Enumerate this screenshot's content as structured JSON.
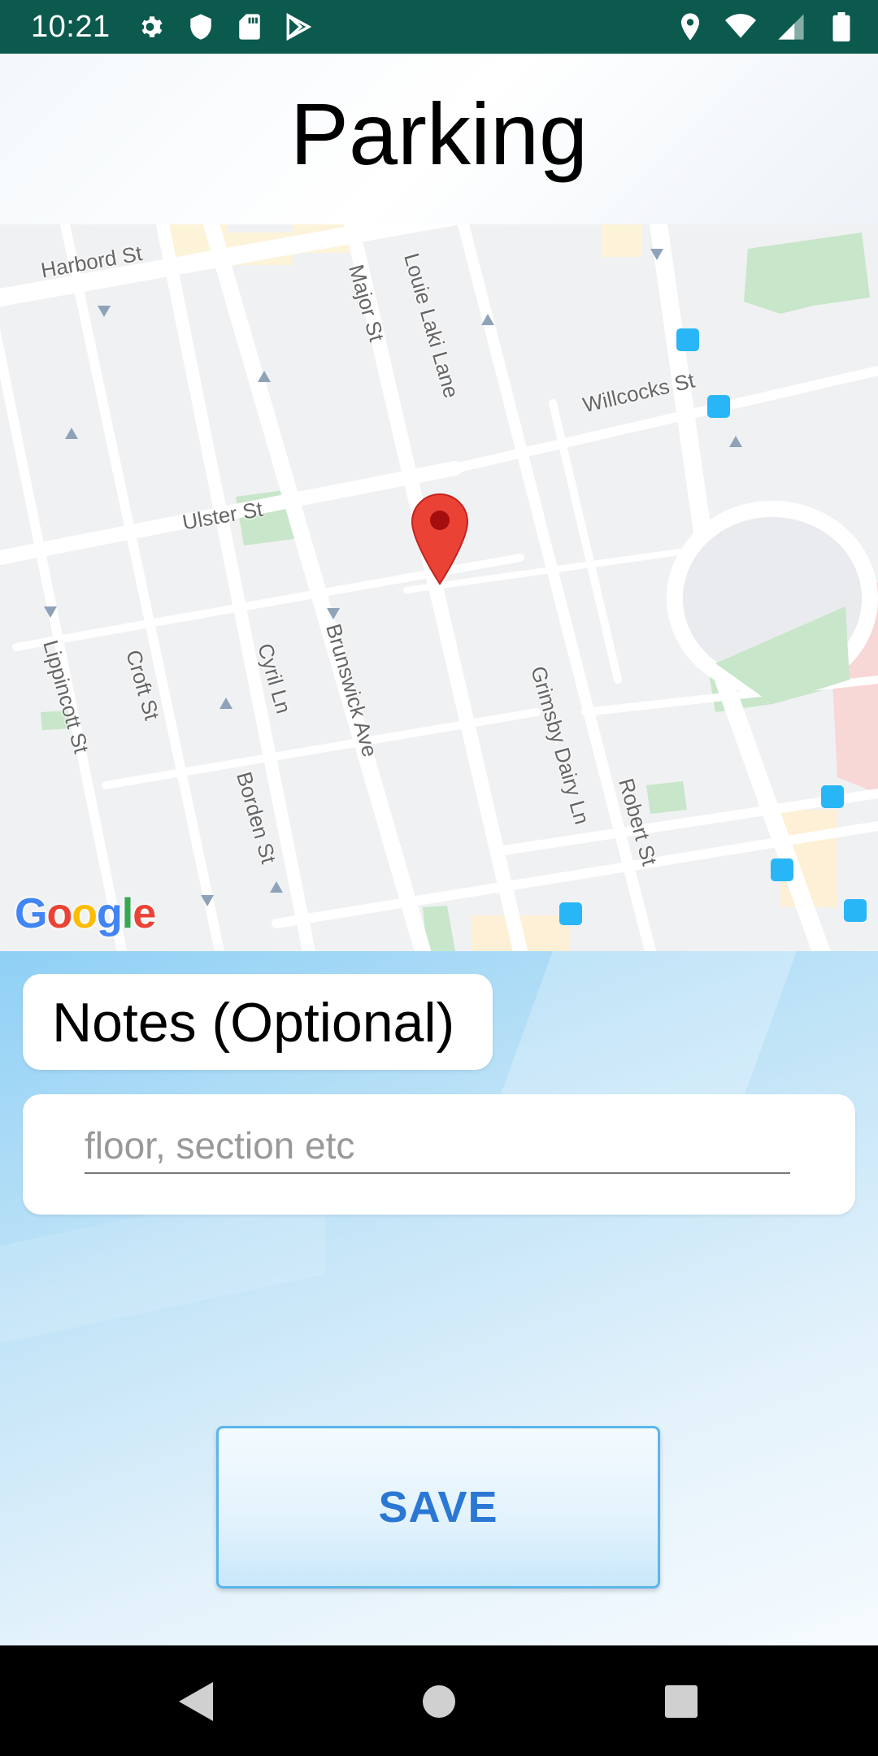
{
  "status_bar": {
    "time": "10:21",
    "left_icons": [
      "gear-icon",
      "shield-icon",
      "sd-card-icon",
      "play-store-icon"
    ],
    "right_icons": [
      "location-icon",
      "wifi-icon",
      "signal-icon",
      "battery-icon"
    ]
  },
  "header": {
    "title": "Parking"
  },
  "map": {
    "logo": "Google",
    "streets": [
      "Harbord St",
      "Major St",
      "Louie Laki Lane",
      "Willcocks St",
      "Ulster St",
      "Lippincott St",
      "Croft St",
      "Cyril Ln",
      "Brunswick Ave",
      "Borden St",
      "Grimsby Dairy Ln",
      "Robert St"
    ],
    "marker_color": "#ea4335"
  },
  "notes": {
    "label": "Notes (Optional)",
    "placeholder": "floor, section etc",
    "value": ""
  },
  "actions": {
    "save_label": "SAVE"
  },
  "nav_bar": {
    "buttons": [
      "back-icon",
      "home-icon",
      "recents-icon"
    ]
  },
  "colors": {
    "status_bar": "#0b5a4d",
    "accent": "#2b78d4",
    "button_border": "#5ab6ea"
  }
}
